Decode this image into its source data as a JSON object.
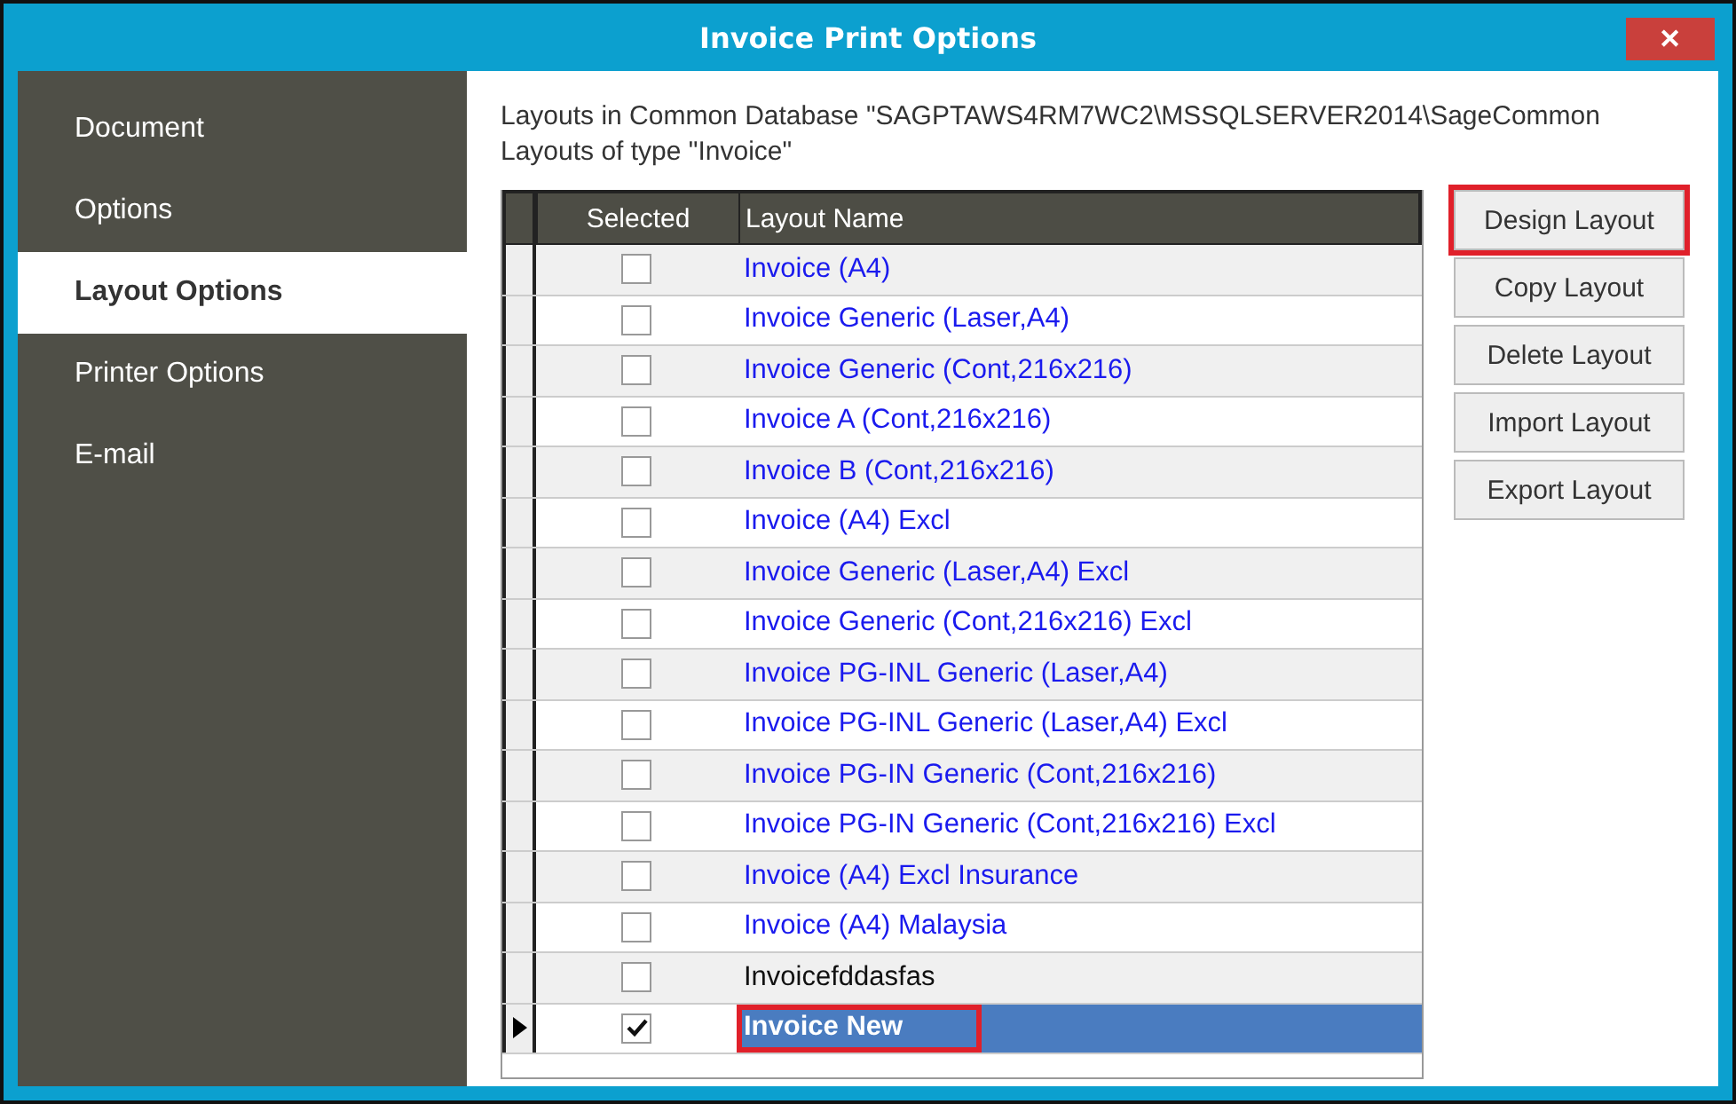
{
  "window": {
    "title": "Invoice Print Options",
    "close": "✕"
  },
  "sidebar": {
    "items": [
      {
        "label": "Document",
        "selected": false
      },
      {
        "label": "Options",
        "selected": false
      },
      {
        "label": "Layout Options",
        "selected": true
      },
      {
        "label": "Printer Options",
        "selected": false
      },
      {
        "label": "E-mail",
        "selected": false
      }
    ]
  },
  "info": [
    "Layouts in Common Database \"SAGPTAWS4RM7WC2\\MSSQLSERVER2014\\SageCommon",
    "Layouts of type \"Invoice\""
  ],
  "table": {
    "columns": [
      "Selected",
      "Layout Name"
    ],
    "rows": [
      {
        "name": "Invoice (A4)",
        "checked": false,
        "selected": false,
        "link": true
      },
      {
        "name": "Invoice Generic (Laser,A4)",
        "checked": false,
        "selected": false,
        "link": true
      },
      {
        "name": "Invoice Generic (Cont,216x216)",
        "checked": false,
        "selected": false,
        "link": true
      },
      {
        "name": "Invoice A (Cont,216x216)",
        "checked": false,
        "selected": false,
        "link": true
      },
      {
        "name": "Invoice B (Cont,216x216)",
        "checked": false,
        "selected": false,
        "link": true
      },
      {
        "name": "Invoice (A4) Excl",
        "checked": false,
        "selected": false,
        "link": true
      },
      {
        "name": "Invoice Generic (Laser,A4) Excl",
        "checked": false,
        "selected": false,
        "link": true
      },
      {
        "name": "Invoice Generic (Cont,216x216) Excl",
        "checked": false,
        "selected": false,
        "link": true
      },
      {
        "name": "Invoice PG-INL Generic (Laser,A4)",
        "checked": false,
        "selected": false,
        "link": true
      },
      {
        "name": "Invoice PG-INL Generic (Laser,A4) Excl",
        "checked": false,
        "selected": false,
        "link": true
      },
      {
        "name": "Invoice PG-IN Generic (Cont,216x216)",
        "checked": false,
        "selected": false,
        "link": true
      },
      {
        "name": "Invoice PG-IN Generic (Cont,216x216) Excl",
        "checked": false,
        "selected": false,
        "link": true
      },
      {
        "name": "Invoice (A4) Excl Insurance",
        "checked": false,
        "selected": false,
        "link": true
      },
      {
        "name": "Invoice (A4) Malaysia",
        "checked": false,
        "selected": false,
        "link": true
      },
      {
        "name": "Invoicefddasfas",
        "checked": false,
        "selected": false,
        "link": false
      },
      {
        "name": "Invoice New",
        "checked": true,
        "selected": true,
        "link": false,
        "highlighted": true
      }
    ]
  },
  "buttons": [
    {
      "label": "Design Layout",
      "highlighted": true
    },
    {
      "label": "Copy Layout",
      "highlighted": false
    },
    {
      "label": "Delete Layout",
      "highlighted": false
    },
    {
      "label": "Import Layout",
      "highlighted": false
    },
    {
      "label": "Export Layout",
      "highlighted": false
    }
  ]
}
